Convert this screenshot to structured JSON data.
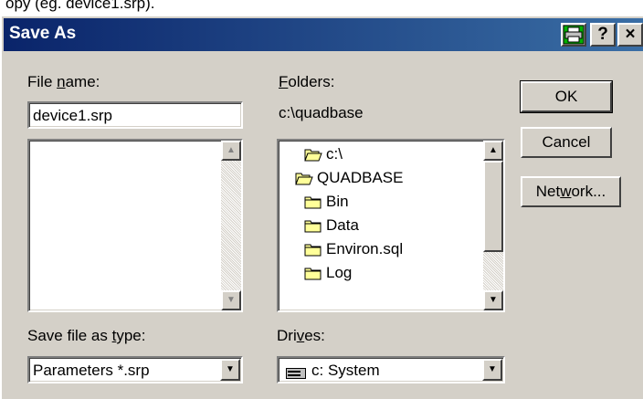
{
  "background_text": "opy (eg. device1.srp).",
  "dialog": {
    "title": "Save As",
    "help_label": "?",
    "close_label": "×"
  },
  "file_name": {
    "label_pre": "File ",
    "label_u": "n",
    "label_post": "ame:",
    "value": "device1.srp"
  },
  "folders": {
    "label_u": "F",
    "label_post": "olders:",
    "current_path": "c:\\quadbase",
    "items": [
      {
        "label": "c:\\",
        "icon": "open-folder-icon"
      },
      {
        "label": "QUADBASE",
        "icon": "open-folder-icon"
      },
      {
        "label": "Bin",
        "icon": "folder-icon"
      },
      {
        "label": "Data",
        "icon": "folder-icon"
      },
      {
        "label": "Environ.sql",
        "icon": "folder-icon"
      },
      {
        "label": "Log",
        "icon": "folder-icon"
      }
    ]
  },
  "buttons": {
    "ok": "OK",
    "cancel": "Cancel",
    "network_pre": "Net",
    "network_u": "w",
    "network_post": "ork..."
  },
  "save_type": {
    "label_pre": "Save file as ",
    "label_u": "t",
    "label_post": "ype:",
    "value": "Parameters *.srp"
  },
  "drives": {
    "label_pre": "Dri",
    "label_u": "v",
    "label_post": "es:",
    "value": "c: System"
  },
  "colors": {
    "titlebar_start": "#0a246a",
    "titlebar_end": "#3a6ea5",
    "face": "#d4d0c8",
    "folder_yellow": "#ffff99"
  }
}
